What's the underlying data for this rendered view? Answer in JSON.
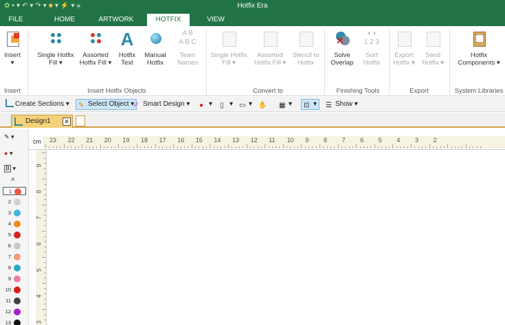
{
  "window": {
    "title": "Hotfix Era"
  },
  "tabs": [
    "FILE",
    "HOME",
    "ARTWORK",
    "HOTFIX",
    "VIEW"
  ],
  "active_tab": "HOTFIX",
  "ribbon": {
    "insert": {
      "label": "Insert",
      "group": "Insert"
    },
    "insert_hotfix_objects": {
      "group": "Insert Hotfix Objects",
      "single_hotfix_fill": "Single Hotfix Fill",
      "assorted_hotfix_fill": "Assorted Hotfix Fill",
      "hotfix_text": "Hotfix Text",
      "manual_hotfix": "Manual Hotfix",
      "team_names": "Team Names"
    },
    "convert_to": {
      "group": "Convert to",
      "single_hotfix_fill": "Single Hotfix Fill",
      "assorted_hotfix_fill": "Assorted Hotfix Fill",
      "stencil_to_hotfix": "Stencil to Hotfix"
    },
    "finishing_tools": {
      "group": "Finishing Tools",
      "solve_overlap": "Solve Overlap",
      "sort_hotfix": "Sort Hotfix"
    },
    "export": {
      "group": "Export",
      "export_hotfix": "Export Hotfix",
      "send_hotfix": "Send Hotfix"
    },
    "system_libraries": {
      "group": "System Libraries",
      "hotfix_components": "Hotfix Components"
    }
  },
  "toolbar": {
    "create_sections": "Create Sections",
    "select_object": "Select Object",
    "smart_design": "Smart Design",
    "show": "Show"
  },
  "document": {
    "tab_name": "Design1"
  },
  "ruler": {
    "unit": "cm",
    "h_numbers": [
      "23",
      "22",
      "21",
      "20",
      "19",
      "18",
      "17",
      "16",
      "15",
      "14",
      "13",
      "12",
      "11",
      "10",
      "9",
      "8",
      "7",
      "6",
      "5",
      "4",
      "3",
      "2"
    ],
    "v_numbers": [
      "9",
      "8",
      "7",
      "6",
      "5",
      "4",
      "3"
    ]
  },
  "left_panel": {
    "letter": "B",
    "colors": [
      {
        "num": "1",
        "color": "#e8584e"
      },
      {
        "num": "2",
        "color": "#d0d0d0"
      },
      {
        "num": "3",
        "color": "#3fb4e0"
      },
      {
        "num": "4",
        "color": "#f08a1c"
      },
      {
        "num": "5",
        "color": "#d9221a"
      },
      {
        "num": "6",
        "color": "#c8c8c8"
      },
      {
        "num": "7",
        "color": "#f09a80"
      },
      {
        "num": "8",
        "color": "#28a8c8"
      },
      {
        "num": "9",
        "color": "#f07aa8"
      },
      {
        "num": "10",
        "color": "#e01818"
      },
      {
        "num": "11",
        "color": "#404040"
      },
      {
        "num": "12",
        "color": "#a020d0"
      },
      {
        "num": "13",
        "color": "#101010"
      }
    ]
  },
  "colors": {
    "accent": "#217346",
    "doc_tab": "#f7d27a"
  }
}
